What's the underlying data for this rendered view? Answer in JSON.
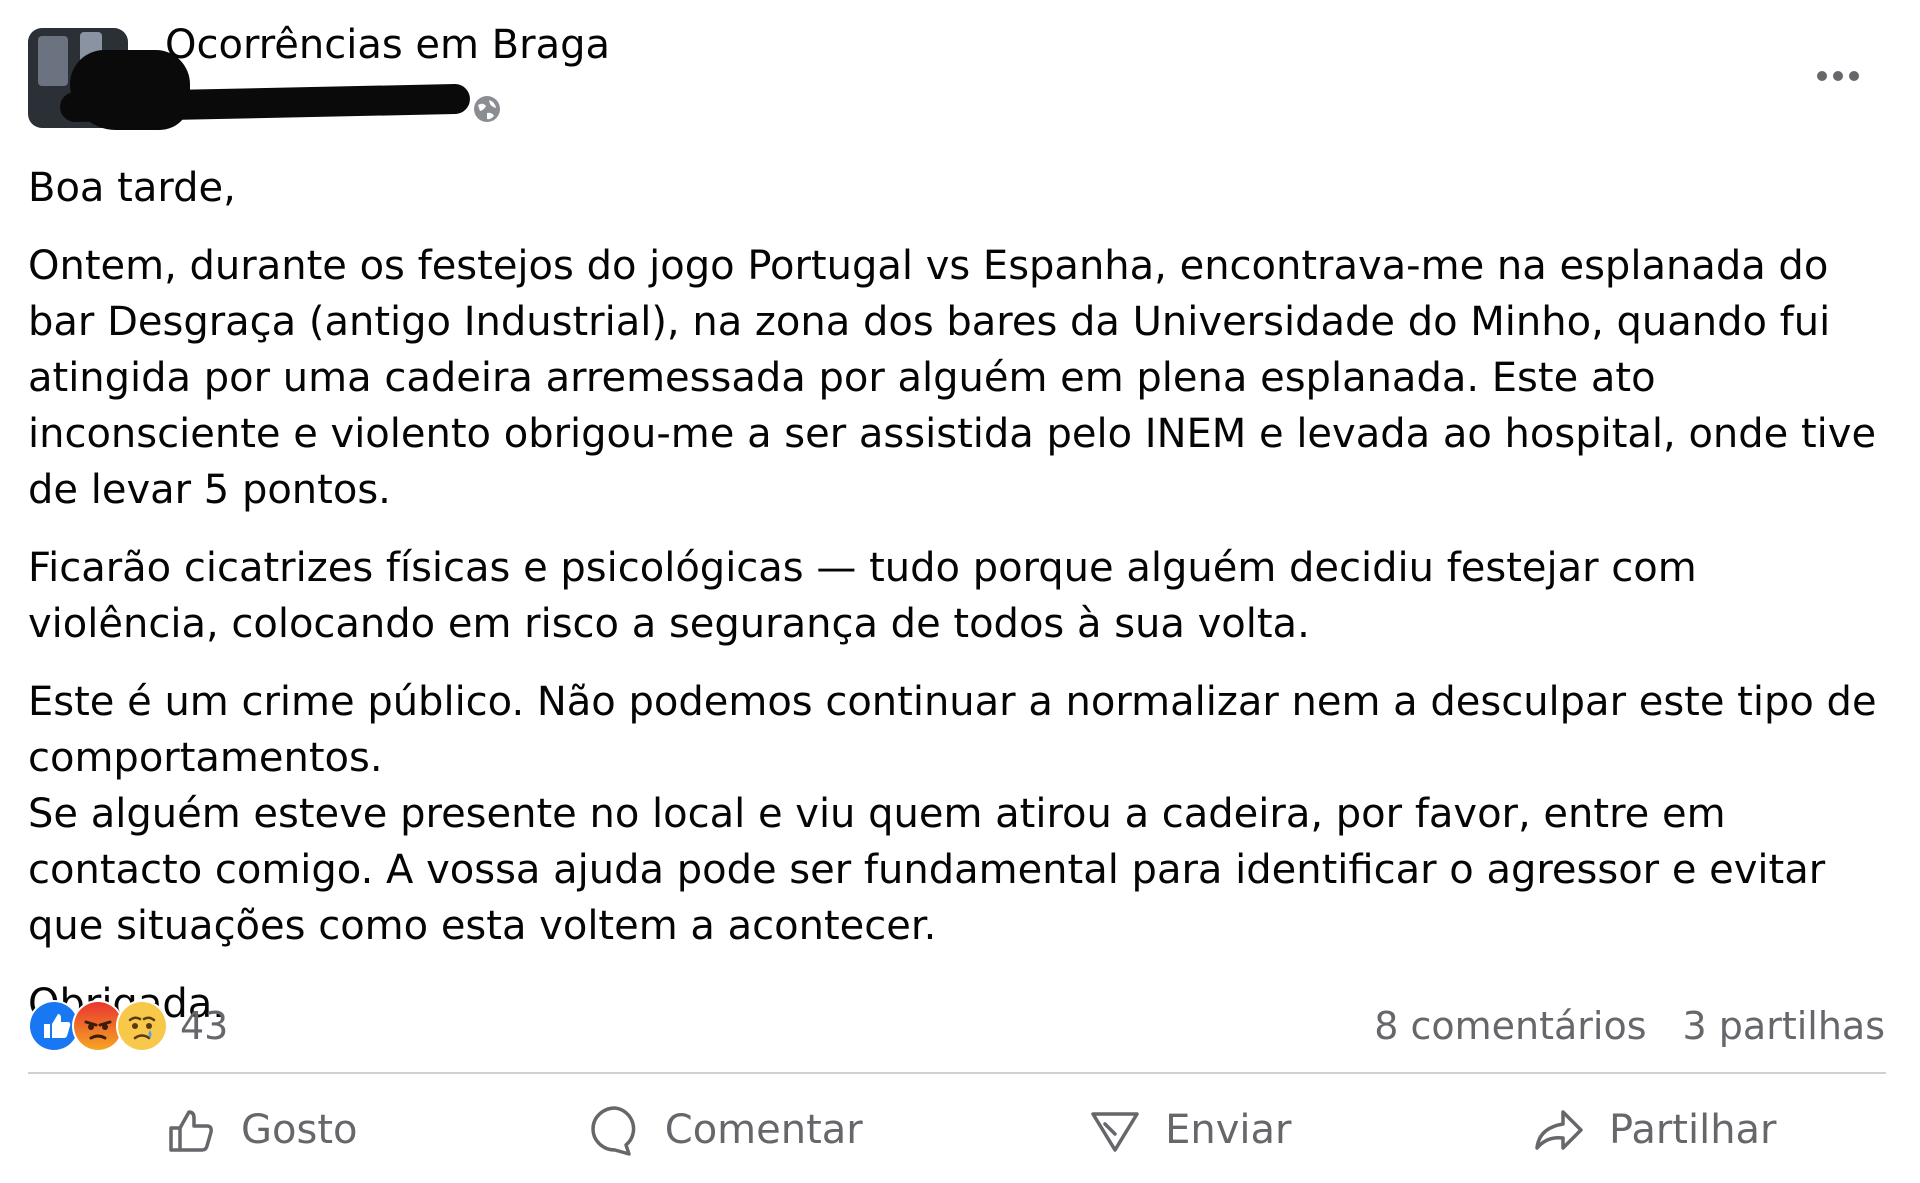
{
  "post": {
    "group_name": "Ocorrências em Braga",
    "privacy_icon": "globe-icon",
    "more_icon": "more-horizontal-icon",
    "paragraphs": [
      "Boa tarde,",
      "Ontem, durante os festejos do jogo Portugal vs Espanha, encontrava-me na esplanada do bar Desgraça (antigo Industrial), na zona dos bares da Universidade do Minho, quando fui atingida por uma cadeira arremessada por alguém em plena esplanada. Este ato inconsciente e violento obrigou-me a ser assistida pelo INEM e levada ao hospital, onde tive de levar 5 pontos.",
      "Ficarão cicatrizes físicas e psicológicas — tudo porque alguém decidiu festejar com violência, colocando em risco a segurança de todos à sua volta.",
      "Este é um crime público. Não podemos continuar a normalizar nem a desculpar este tipo de comportamentos.",
      "Se alguém esteve presente no local e viu quem atirou a cadeira, por favor, entre em contacto comigo. A vossa ajuda pode ser fundamental para identificar o agressor e evitar que situações como esta voltem a acontecer.",
      "Obrigada."
    ]
  },
  "reactions": {
    "icons": [
      "like-reaction-icon",
      "angry-reaction-icon",
      "sad-reaction-icon"
    ],
    "count": "43",
    "comments": "8 comentários",
    "shares": "3 partilhas"
  },
  "actions": {
    "like": "Gosto",
    "comment": "Comentar",
    "send": "Enviar",
    "share": "Partilhar"
  },
  "colors": {
    "text": "#050505",
    "secondary": "#65676b",
    "like_blue": "#1877f2",
    "angry_red": "#e9710f",
    "divider": "#ced0d4"
  }
}
